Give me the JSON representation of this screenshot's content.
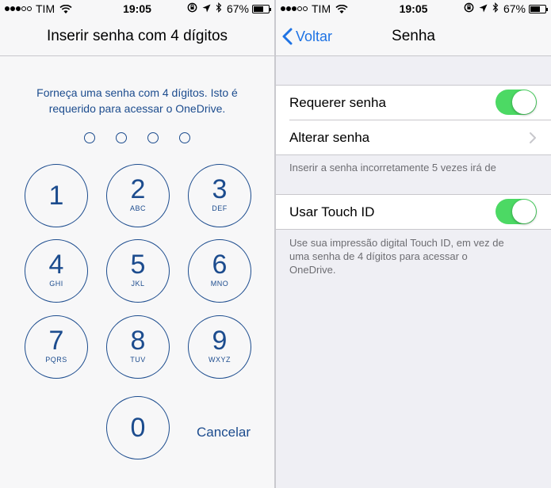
{
  "left": {
    "status": {
      "carrier": "TIM",
      "time": "19:05",
      "battery": "67%",
      "battery_level": 0.67,
      "signal_bars_filled": 3,
      "signal_bars_total": 5
    },
    "nav": {
      "title": "Inserir senha com 4 dígitos"
    },
    "prompt_line1": "Forneça uma senha com 4 dígitos. Isto é",
    "prompt_line2": "requerido para acessar o OneDrive.",
    "keypad": {
      "k1": {
        "digit": "1",
        "letters": ""
      },
      "k2": {
        "digit": "2",
        "letters": "ABC"
      },
      "k3": {
        "digit": "3",
        "letters": "DEF"
      },
      "k4": {
        "digit": "4",
        "letters": "GHI"
      },
      "k5": {
        "digit": "5",
        "letters": "JKL"
      },
      "k6": {
        "digit": "6",
        "letters": "MNO"
      },
      "k7": {
        "digit": "7",
        "letters": "PQRS"
      },
      "k8": {
        "digit": "8",
        "letters": "TUV"
      },
      "k9": {
        "digit": "9",
        "letters": "WXYZ"
      },
      "k0": {
        "digit": "0",
        "letters": ""
      }
    },
    "cancel_label": "Cancelar"
  },
  "right": {
    "status": {
      "carrier": "TIM",
      "time": "19:05",
      "battery": "67%",
      "battery_level": 0.67
    },
    "nav": {
      "back_label": "Voltar",
      "title": "Senha"
    },
    "rows": {
      "require_passcode": {
        "label": "Requerer senha",
        "on": true
      },
      "change_passcode": {
        "label": "Alterar senha"
      },
      "touch_id": {
        "label": "Usar Touch ID",
        "on": true
      }
    },
    "footnote1": "Inserir a senha incorretamente 5 vezes irá de",
    "footnote2_line1": "Use sua impressão digital Touch ID, em vez de",
    "footnote2_line2": "uma senha de 4 dígitos para acessar o",
    "footnote2_line3": "OneDrive."
  },
  "colors": {
    "accent_blue": "#1c4c8e",
    "ios_blue": "#1f73e4",
    "switch_green": "#4cd964"
  }
}
